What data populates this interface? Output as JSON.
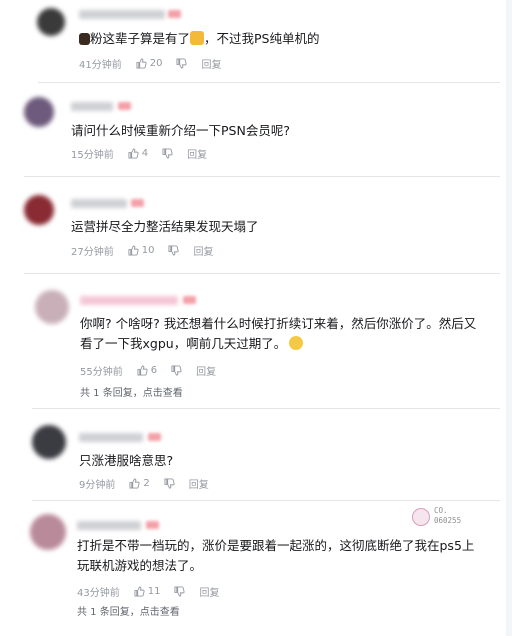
{
  "comments": [
    {
      "avatar_color": "#3a3a3a",
      "username_color": "#c9c9cc",
      "level_color": "#f3a0a7",
      "text_prefix_icon": "lock-emoji",
      "lines": [
        "粉这辈子算是有了",
        "，不过我PS纯单机的"
      ],
      "inline_emoji": "thumbs-up-emoji",
      "time": "41分钟前",
      "likes": "20",
      "reply_label": "回复"
    },
    {
      "avatar_color": "#6d5a7c",
      "username_color": "#c9c9cc",
      "level_color": "#f3a0a7",
      "lines": [
        "请问什么时候重新介绍一下PSN会员呢?"
      ],
      "time": "15分钟前",
      "likes": "4",
      "reply_label": "回复"
    },
    {
      "avatar_color": "#8a2a33",
      "username_color": "#c9c9cc",
      "level_color": "#f3a0a7",
      "lines": [
        "运营拼尽全力整活结果发现天塌了"
      ],
      "time": "27分钟前",
      "likes": "10",
      "reply_label": "回复"
    },
    {
      "avatar_color": "#c9b0b8",
      "username_color": "#f2b8cf",
      "level_color": "#f3a0a7",
      "lines": [
        "你啊? 个啥呀? 我还想着什么时候打折续订来着，然后你涨价了。然后又",
        "看了一下我xgpu，啊前几天过期了。"
      ],
      "inline_emoji": "laughing-emoji",
      "time": "55分钟前",
      "likes": "6",
      "reply_label": "回复",
      "sub_text": "共 1 条回复，点击查看"
    },
    {
      "avatar_color": "#3b3b42",
      "username_color": "#c9c9cc",
      "level_color": "#f3a0a7",
      "lines": [
        "只涨港服啥意思?"
      ],
      "time": "9分钟前",
      "likes": "2",
      "reply_label": "回复"
    },
    {
      "avatar_color": "#b98a9a",
      "username_color": "#c9c9cc",
      "level_color": "#f3a0a7",
      "lines": [
        "打折是不带一档玩的，涨价是要跟着一起涨的，这彻底断绝了我在ps5上",
        "玩联机游戏的想法了。"
      ],
      "time": "43分钟前",
      "likes": "11",
      "reply_label": "回复",
      "sub_text": "共 1 条回复，点击查看"
    }
  ],
  "watermark": {
    "line1": "CO.",
    "line2": "060255"
  }
}
